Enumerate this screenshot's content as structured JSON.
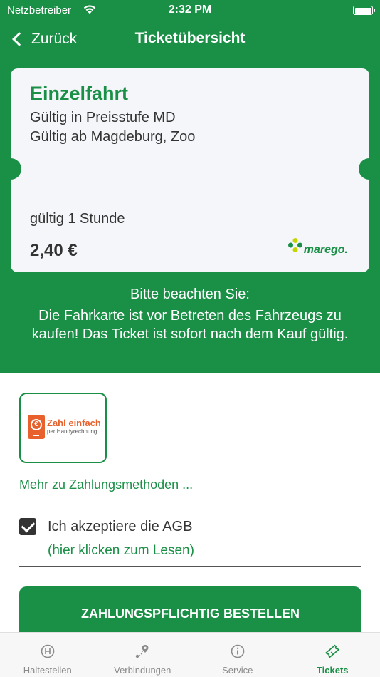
{
  "status_bar": {
    "carrier": "Netzbetreiber",
    "time": "2:32 PM"
  },
  "nav": {
    "back_label": "Zurück",
    "title": "Ticketübersicht"
  },
  "ticket": {
    "title": "Einzelfahrt",
    "line1": "Gültig in Preisstufe MD",
    "line2": "Gültig ab Magdeburg, Zoo",
    "validity": "gültig 1 Stunde",
    "price": "2,40 €",
    "brand": "marego."
  },
  "notice": {
    "heading": "Bitte beachten Sie:",
    "text": "Die Fahrkarte ist vor Betreten des Fahrzeugs zu kaufen! Das Ticket ist sofort nach dem Kauf gültig."
  },
  "payment": {
    "method_title": "Zahl einfach",
    "method_subtitle": "per Handyrechnung",
    "more_link": "Mehr zu Zahlungsmethoden ..."
  },
  "agb": {
    "label": "Ich akzeptiere die AGB",
    "link": "(hier klicken zum Lesen)",
    "checked": true
  },
  "order_button": "ZAHLUNGSPFLICHTIG BESTELLEN",
  "tabs": [
    {
      "label": "Haltestellen",
      "icon": "stop-h-icon",
      "active": false
    },
    {
      "label": "Verbindungen",
      "icon": "route-icon",
      "active": false
    },
    {
      "label": "Service",
      "icon": "info-icon",
      "active": false
    },
    {
      "label": "Tickets",
      "icon": "ticket-icon",
      "active": true
    }
  ],
  "colors": {
    "primary": "#1a8f46",
    "card": "#f4f6f9",
    "payment_orange": "#e8612c"
  }
}
